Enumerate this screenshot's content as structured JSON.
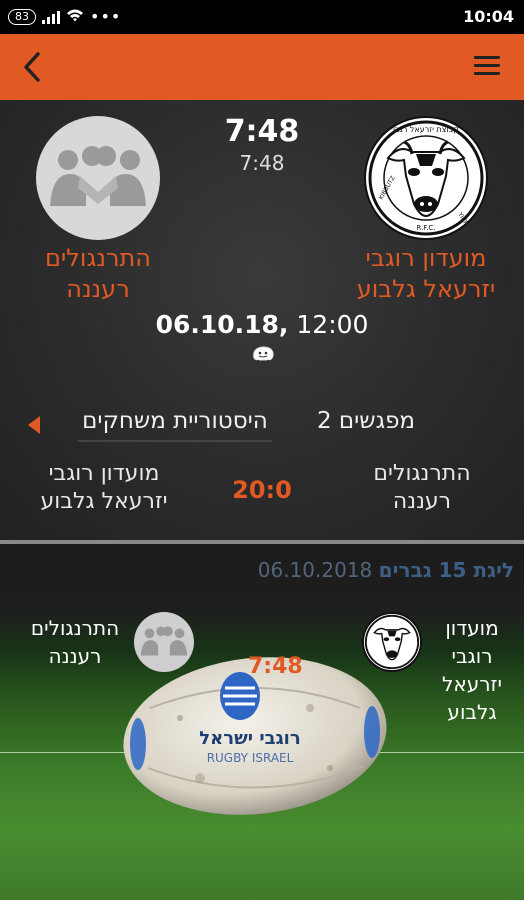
{
  "status": {
    "battery": "83",
    "time": "10:04"
  },
  "match": {
    "time_big": "7:48",
    "time_small": "7:48",
    "home_team": "מועדון רוגבי יזרעאל גלבוע",
    "away_team": "התרנגולים רעננה",
    "date_bold": "06.10.18,",
    "date_time": " 12:00"
  },
  "tabs": {
    "meetings": "2 מפגשים",
    "history": "היסטוריית משחקים"
  },
  "history_row": {
    "left_team": "מועדון רוגבי יזרעאל גלבוע",
    "score": "20:0",
    "right_team": "התרנגולים רעננה"
  },
  "fixture": {
    "league": "ליגת 15 גברים",
    "date": "06.10.2018",
    "left_team": "התרנגולים רעננה",
    "right_team": "מועדון רוגבי יזרעאל גלבוע",
    "time": "7:48",
    "ball_text_he": "רוגבי ישראל",
    "ball_text_en": "RUGBY ISRAEL"
  },
  "logo": {
    "ring_top": "קבוצת יזרעאל רגבי",
    "left": "KIBBUTZ",
    "right": "YIZREEL",
    "bottom": "R.F.C."
  },
  "colors": {
    "accent": "#e15a24",
    "appbar": "#e15a24",
    "league": "#3d5f86"
  },
  "icons": {
    "back": "chevron-left-icon",
    "menu": "hamburger-menu-icon",
    "waze": "waze-icon",
    "tab_prev": "caret-left-icon"
  }
}
